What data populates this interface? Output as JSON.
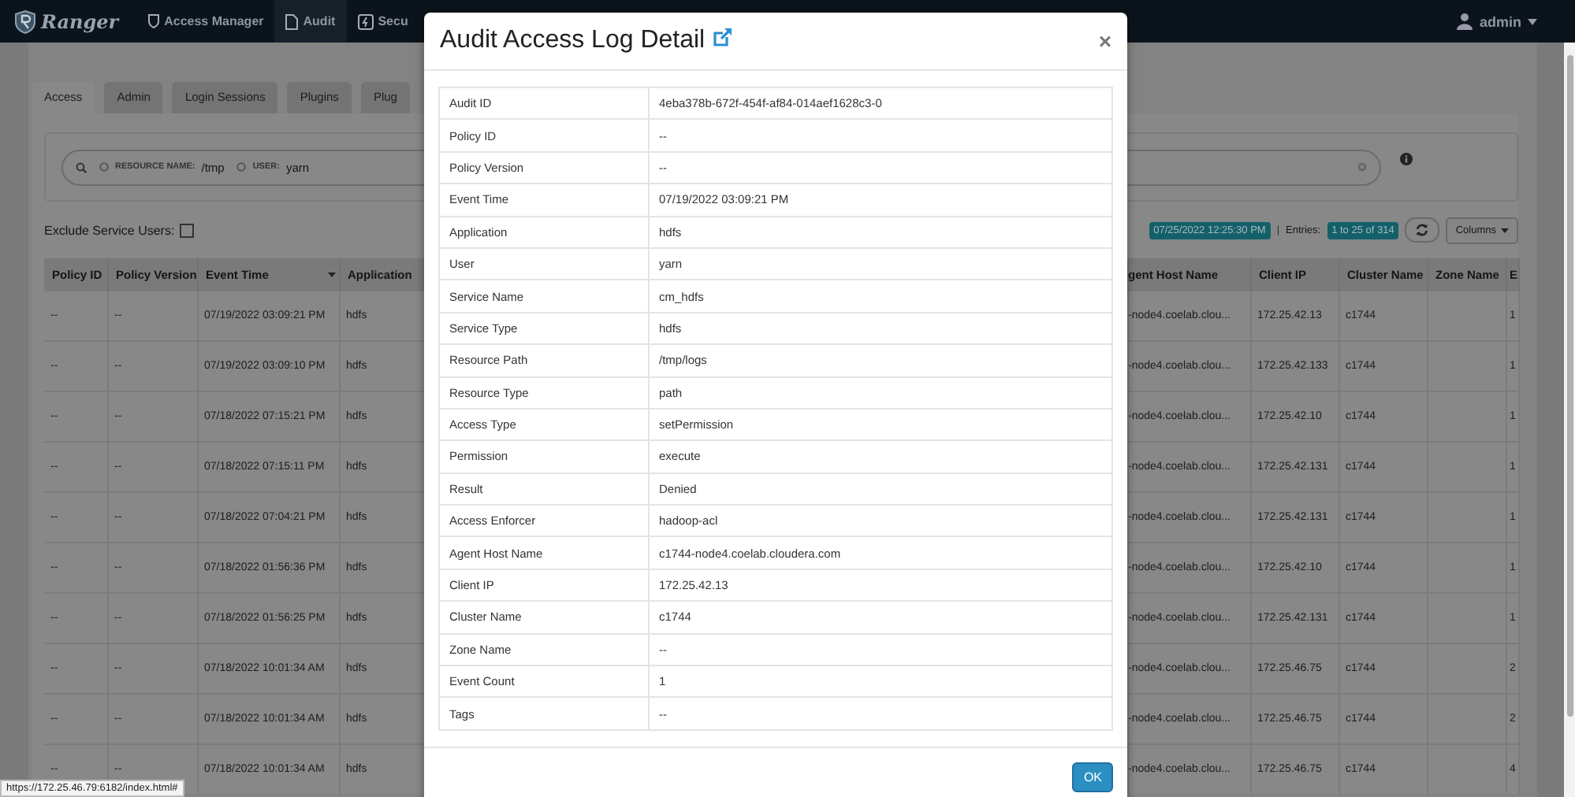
{
  "navbar": {
    "brand": "Ranger",
    "items": [
      {
        "label": "Access Manager",
        "selected": false
      },
      {
        "label": "Audit",
        "selected": true
      },
      {
        "label": "Secu",
        "selected": false
      }
    ],
    "user": "admin"
  },
  "tabs": [
    {
      "label": "Access",
      "selected": true
    },
    {
      "label": "Admin",
      "selected": false
    },
    {
      "label": "Login Sessions",
      "selected": false
    },
    {
      "label": "Plugins",
      "selected": false
    },
    {
      "label": "Plug",
      "selected": false
    }
  ],
  "search": {
    "facets": [
      {
        "key": "RESOURCE NAME:",
        "value": "/tmp"
      },
      {
        "key": "USER:",
        "value": "yarn"
      }
    ]
  },
  "exclude_service_users": {
    "label": "Exclude Service Users:",
    "checked": false
  },
  "toolbar": {
    "last_updated": "07/25/2022 12:25:30 PM",
    "separator": "|",
    "entries_label": "Entries:",
    "entries": "1 to 25 of 314",
    "columns_button": "Columns"
  },
  "table": {
    "left_columns": [
      {
        "label": "Policy ID",
        "sorted": false
      },
      {
        "label": "Policy Version",
        "sorted": false
      },
      {
        "label": "Event Time",
        "sorted": true
      },
      {
        "label": "Application",
        "sorted": false
      }
    ],
    "right_columns": [
      {
        "label": "gent Host Name",
        "sorted": false
      },
      {
        "label": "Client IP",
        "sorted": false
      },
      {
        "label": "Cluster Name",
        "sorted": false
      },
      {
        "label": "Zone Name",
        "sorted": false
      },
      {
        "label": "E",
        "sorted": false
      }
    ],
    "rows": [
      {
        "policy_id": "--",
        "policy_version": "--",
        "event_time": "07/19/2022 03:09:21 PM",
        "application": "hdfs",
        "agent_host_name": "-node4.coelab.clou...",
        "client_ip": "172.25.42.13",
        "cluster_name": "c1744",
        "column_e": "1"
      },
      {
        "policy_id": "--",
        "policy_version": "--",
        "event_time": "07/19/2022 03:09:10 PM",
        "application": "hdfs",
        "agent_host_name": "-node4.coelab.clou...",
        "client_ip": "172.25.42.133",
        "cluster_name": "c1744",
        "column_e": "1"
      },
      {
        "policy_id": "--",
        "policy_version": "--",
        "event_time": "07/18/2022 07:15:21 PM",
        "application": "hdfs",
        "agent_host_name": "-node4.coelab.clou...",
        "client_ip": "172.25.42.10",
        "cluster_name": "c1744",
        "column_e": "1"
      },
      {
        "policy_id": "--",
        "policy_version": "--",
        "event_time": "07/18/2022 07:15:11 PM",
        "application": "hdfs",
        "agent_host_name": "-node4.coelab.clou...",
        "client_ip": "172.25.42.131",
        "cluster_name": "c1744",
        "column_e": "1"
      },
      {
        "policy_id": "--",
        "policy_version": "--",
        "event_time": "07/18/2022 07:04:21 PM",
        "application": "hdfs",
        "agent_host_name": "-node4.coelab.clou...",
        "client_ip": "172.25.42.131",
        "cluster_name": "c1744",
        "column_e": "1"
      },
      {
        "policy_id": "--",
        "policy_version": "--",
        "event_time": "07/18/2022 01:56:36 PM",
        "application": "hdfs",
        "agent_host_name": "-node4.coelab.clou...",
        "client_ip": "172.25.42.10",
        "cluster_name": "c1744",
        "column_e": "1"
      },
      {
        "policy_id": "--",
        "policy_version": "--",
        "event_time": "07/18/2022 01:56:25 PM",
        "application": "hdfs",
        "agent_host_name": "-node4.coelab.clou...",
        "client_ip": "172.25.42.131",
        "cluster_name": "c1744",
        "column_e": "1"
      },
      {
        "policy_id": "--",
        "policy_version": "--",
        "event_time": "07/18/2022 10:01:34 AM",
        "application": "hdfs",
        "agent_host_name": "-node4.coelab.clou...",
        "client_ip": "172.25.46.75",
        "cluster_name": "c1744",
        "column_e": "2"
      },
      {
        "policy_id": "--",
        "policy_version": "--",
        "event_time": "07/18/2022 10:01:34 AM",
        "application": "hdfs",
        "agent_host_name": "-node4.coelab.clou...",
        "client_ip": "172.25.46.75",
        "cluster_name": "c1744",
        "column_e": "2"
      },
      {
        "policy_id": "--",
        "policy_version": "--",
        "event_time": "07/18/2022 10:01:34 AM",
        "application": "hdfs",
        "agent_host_name": "-node4.coelab.clou...",
        "client_ip": "172.25.46.75",
        "cluster_name": "c1744",
        "column_e": "4"
      }
    ]
  },
  "modal": {
    "title": "Audit Access Log Detail",
    "close": "×",
    "rows": [
      {
        "label": "Audit ID",
        "value": "4eba378b-672f-454f-af84-014aef1628c3-0"
      },
      {
        "label": "Policy ID",
        "value": "--"
      },
      {
        "label": "Policy Version",
        "value": "--"
      },
      {
        "label": "Event Time",
        "value": "07/19/2022 03:09:21 PM"
      },
      {
        "label": "Application",
        "value": "hdfs"
      },
      {
        "label": "User",
        "value": "yarn"
      },
      {
        "label": "Service Name",
        "value": "cm_hdfs"
      },
      {
        "label": "Service Type",
        "value": "hdfs"
      },
      {
        "label": "Resource Path",
        "value": "/tmp/logs"
      },
      {
        "label": "Resource Type",
        "value": "path"
      },
      {
        "label": "Access Type",
        "value": "setPermission"
      },
      {
        "label": "Permission",
        "value": "execute"
      },
      {
        "label": "Result",
        "value": "Denied"
      },
      {
        "label": "Access Enforcer",
        "value": "hadoop-acl"
      },
      {
        "label": "Agent Host Name",
        "value": "c1744-node4.coelab.cloudera.com"
      },
      {
        "label": "Client IP",
        "value": "172.25.42.13"
      },
      {
        "label": "Cluster Name",
        "value": "c1744"
      },
      {
        "label": "Zone Name",
        "value": "--"
      },
      {
        "label": "Event Count",
        "value": "1"
      },
      {
        "label": "Tags",
        "value": "--"
      }
    ],
    "ok_button": "OK"
  },
  "status_url": "https://172.25.46.79:6182/index.html#"
}
